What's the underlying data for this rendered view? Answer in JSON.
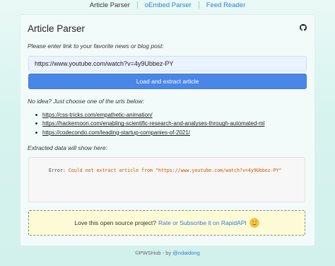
{
  "nav": {
    "tabs": [
      {
        "label": "Article Parser"
      },
      {
        "label": "oEmbed Parser"
      },
      {
        "label": "Feed Reader"
      }
    ]
  },
  "header": {
    "title": "Article Parser",
    "icon": "github-icon"
  },
  "form": {
    "prompt": "Please enter link to your favorite news or blog post:",
    "url_value": "https://www.youtube.com/watch?v=4y9Ubbez-PY",
    "submit_label": "Load and extract article"
  },
  "suggestions": {
    "intro": "No idea? Just choose one of the urls below:",
    "urls": [
      "https://css-tricks.com/empathetic-animation/",
      "https://hackernoon.com/enabling-scientific-research-and-analyses-through-automated-ml",
      "https://codecondo.com/leading-startup-companies-of-2021/"
    ]
  },
  "output": {
    "label": "Extracted data will show here:",
    "error_label": "Error:",
    "error_message": "Could not extract article from \"https://www.youtube.com/watch?v=4y9Ubbez-PY\""
  },
  "support": {
    "text": "Love this open source project?",
    "link": "Rate or Subscribe it on RapidAPI",
    "icon": "smiley-icon"
  },
  "footer": {
    "brand": "©PWSHub",
    "by": "- by",
    "author": "@ndaidong"
  },
  "colors": {
    "accent": "#4a86e8",
    "link": "#2f7fd8",
    "error": "#d35400",
    "support_bg": "#fdfbd6"
  }
}
